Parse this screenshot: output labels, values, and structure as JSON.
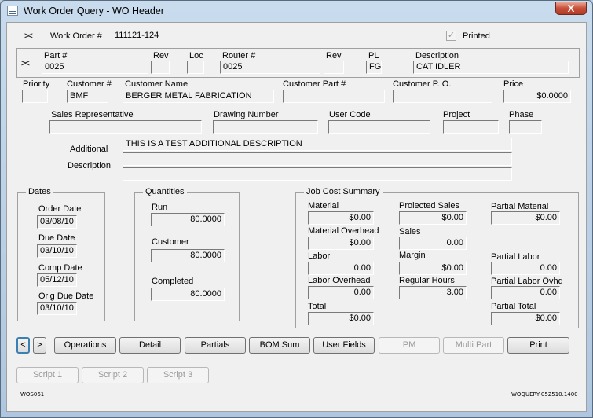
{
  "window": {
    "title": "Work Order Query - WO Header",
    "close_label": "X"
  },
  "header": {
    "work_order_label": "Work Order #",
    "work_order_value": "111121-124",
    "printed_label": "Printed",
    "printed_checked": true
  },
  "part": {
    "part_label": "Part #",
    "part_value": "0025",
    "rev_label": "Rev",
    "rev_value": "",
    "loc_label": "Loc",
    "loc_value": "",
    "router_label": "Router #",
    "router_value": "0025",
    "router_rev_label": "Rev",
    "router_rev_value": "",
    "pl_label": "PL",
    "pl_value": "FG",
    "description_label": "Description",
    "description_value": "CAT IDLER"
  },
  "customer": {
    "priority_label": "Priority",
    "priority_value": "",
    "customer_num_label": "Customer #",
    "customer_num_value": "BMF",
    "customer_name_label": "Customer Name",
    "customer_name_value": "BERGER METAL FABRICATION",
    "customer_part_label": "Customer Part #",
    "customer_part_value": "",
    "customer_po_label": "Customer P. O.",
    "customer_po_value": "",
    "price_label": "Price",
    "price_value": "$0.0000"
  },
  "misc": {
    "sales_rep_label": "Sales Representative",
    "sales_rep_value": "",
    "drawing_label": "Drawing Number",
    "drawing_value": "",
    "user_code_label": "User Code",
    "user_code_value": "",
    "project_label": "Project",
    "project_value": "",
    "phase_label": "Phase",
    "phase_value": ""
  },
  "additional": {
    "label1": "Additional",
    "label2": "Description",
    "lines": [
      "THIS IS A TEST ADDITIONAL DESCRIPTION",
      "",
      ""
    ]
  },
  "dates": {
    "title": "Dates",
    "order_label": "Order Date",
    "order_value": "03/08/10",
    "due_label": "Due Date",
    "due_value": "03/10/10",
    "comp_label": "Comp Date",
    "comp_value": "05/12/10",
    "orig_label": "Orig Due Date",
    "orig_value": "03/10/10"
  },
  "quantities": {
    "title": "Quantities",
    "run_label": "Run",
    "run_value": "80.0000",
    "customer_label": "Customer",
    "customer_value": "80.0000",
    "completed_label": "Completed",
    "completed_value": "80.0000"
  },
  "job_cost": {
    "title": "Job Cost Summary",
    "material_label": "Material",
    "material_value": "$0.00",
    "material_overhead_label": "Material Overhead",
    "material_overhead_value": "$0.00",
    "labor_label": "Labor",
    "labor_value": "0.00",
    "labor_overhead_label": "Labor Overhead",
    "labor_overhead_value": "0.00",
    "total_label": "Total",
    "total_value": "$0.00",
    "projected_sales_label": "Proiected Sales",
    "projected_sales_value": "$0.00",
    "sales_label": "Sales",
    "sales_value": "0.00",
    "margin_label": "Margin",
    "margin_value": "$0.00",
    "regular_hours_label": "Regular Hours",
    "regular_hours_value": "3.00",
    "partial_material_label": "Partial Material",
    "partial_material_value": "$0.00",
    "partial_labor_label": "Partial Labor",
    "partial_labor_value": "0.00",
    "partial_labor_ovhd_label": "Partial Labor Ovhd",
    "partial_labor_ovhd_value": "0.00",
    "partial_total_label": "Partial Total",
    "partial_total_value": "$0.00"
  },
  "buttons": {
    "prev": "<",
    "next": ">",
    "operations": "Operations",
    "detail": "Detail",
    "partials": "Partials",
    "bom_sum": "BOM Sum",
    "user_fields": "User Fields",
    "pm": "PM",
    "multi_part": "Multi Part",
    "print": "Print",
    "script1": "Script 1",
    "script2": "Script 2",
    "script3": "Script 3"
  },
  "footer": {
    "left_code": "WOS061",
    "right_code": "WOQUERY-052510.1400"
  }
}
